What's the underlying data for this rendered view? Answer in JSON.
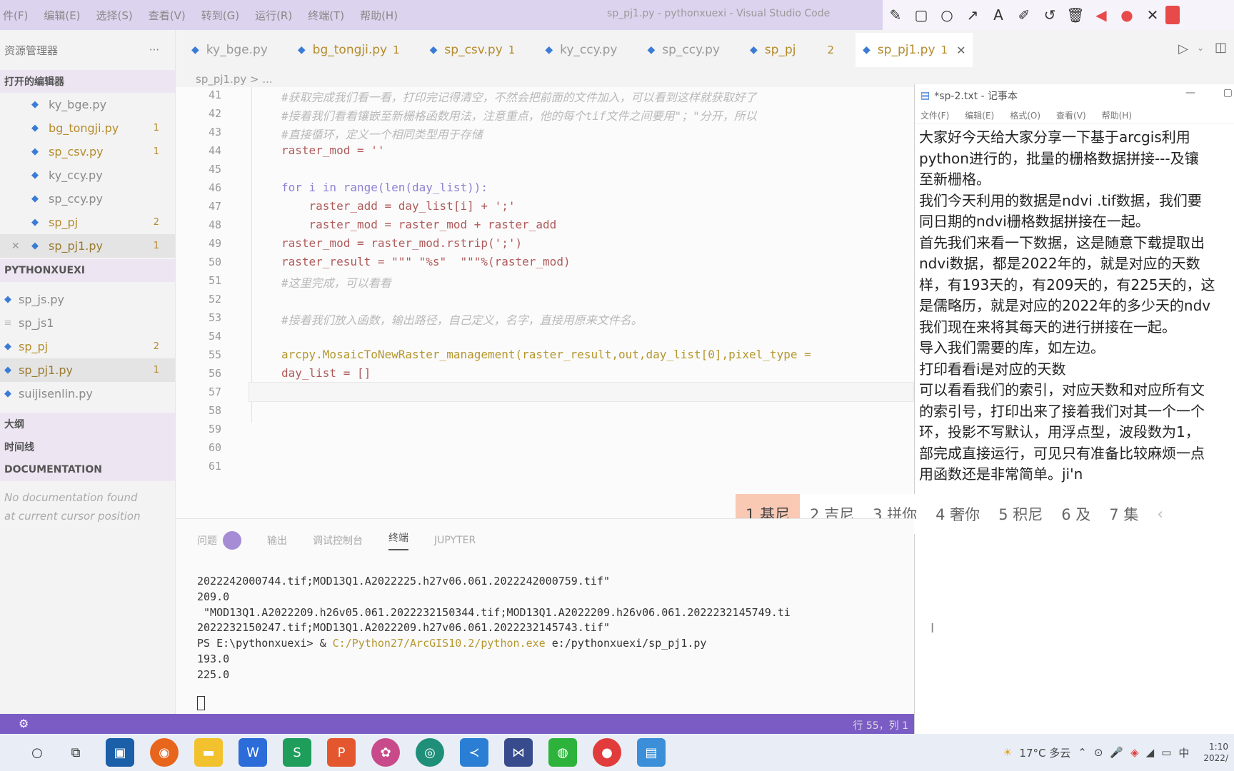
{
  "titlebar": {
    "menus": [
      "件(F)",
      "编辑(E)",
      "选择(S)",
      "查看(V)",
      "转到(G)",
      "运行(R)",
      "终端(T)",
      "帮助(H)"
    ],
    "title": "sp_pj1.py - pythonxuexi - Visual Studio Code"
  },
  "sidebar": {
    "explorer_label": "资源管理器",
    "more": "···",
    "open_editors_header": "打开的编辑器",
    "open_editors": [
      {
        "name": "ky_bge.py",
        "badge": ""
      },
      {
        "name": "bg_tongji.py",
        "badge": "1"
      },
      {
        "name": "sp_csv.py",
        "badge": "1"
      },
      {
        "name": "ky_ccy.py",
        "badge": ""
      },
      {
        "name": "sp_ccy.py",
        "badge": ""
      },
      {
        "name": "sp_pj",
        "badge": "2"
      },
      {
        "name": "sp_pj1.py",
        "badge": "1",
        "close": "✕"
      }
    ],
    "project_header": "PYTHONXUEXI",
    "project_files": [
      {
        "name": "sp_js.py",
        "badge": ""
      },
      {
        "name": "sp_js1",
        "badge": ""
      },
      {
        "name": "sp_pj",
        "badge": "2"
      },
      {
        "name": "sp_pj1.py",
        "badge": "1"
      },
      {
        "name": "suijisenlin.py",
        "badge": ""
      }
    ],
    "outline_header": "大纲",
    "timeline_header": "时间线",
    "documentation_header": "DOCUMENTATION",
    "doc_note_1": "No documentation found",
    "doc_note_2": "at current cursor position"
  },
  "tabs": [
    {
      "name": "ky_bge.py",
      "badge": ""
    },
    {
      "name": "bg_tongji.py",
      "badge": "1"
    },
    {
      "name": "sp_csv.py",
      "badge": "1"
    },
    {
      "name": "ky_ccy.py",
      "badge": ""
    },
    {
      "name": "sp_ccy.py",
      "badge": ""
    },
    {
      "name": "sp_pj",
      "badge": "2"
    },
    {
      "name": "sp_pj1.py",
      "badge": "1",
      "close": "✕"
    }
  ],
  "breadcrumb": "sp_pj1.py > ...",
  "editor": {
    "lines": [
      {
        "n": "41",
        "code": "#获取完成我们看一看，打印完记得清空，不然会把前面的文件加入，可以看到这样就获取好了"
      },
      {
        "n": "42",
        "code": "#接着我们看看镶嵌至新栅格函数用法，注意重点，他的每个tif文件之间要用\"；\"分开，所以"
      },
      {
        "n": "43",
        "code": "#直接循环，定义一个相同类型用于存储"
      },
      {
        "n": "44",
        "code": "raster_mod = ''"
      },
      {
        "n": "45",
        "code": ""
      },
      {
        "n": "46",
        "code": "for i in range(len(day_list)):"
      },
      {
        "n": "47",
        "code": "    raster_add = day_list[i] + ';'"
      },
      {
        "n": "48",
        "code": "    raster_mod = raster_mod + raster_add"
      },
      {
        "n": "49",
        "code": "raster_mod = raster_mod.rstrip(';')"
      },
      {
        "n": "50",
        "code": "raster_result = \"\"\" \"%s\"  \"\"\"%(raster_mod)"
      },
      {
        "n": "51",
        "code": "#这里完成，可以看看"
      },
      {
        "n": "52",
        "code": ""
      },
      {
        "n": "53",
        "code": "#接着我们放入函数，输出路径，自己定义，名字，直接用原来文件名。"
      },
      {
        "n": "54",
        "code": ""
      },
      {
        "n": "55",
        "code": "arcpy.MosaicToNewRaster_management(raster_result,out,day_list[0],pixel_type ="
      },
      {
        "n": "56",
        "code": "day_list = []"
      },
      {
        "n": "57",
        "code": ""
      },
      {
        "n": "58",
        "code": ""
      },
      {
        "n": "59",
        "code": ""
      },
      {
        "n": "60",
        "code": ""
      },
      {
        "n": "61",
        "code": ""
      }
    ]
  },
  "notepad": {
    "title": "*sp-2.txt - 记事本",
    "menus": [
      "文件(F)",
      "编辑(E)",
      "格式(O)",
      "查看(V)",
      "帮助(H)"
    ],
    "lines": [
      "大家好今天给大家分享一下基于arcgis利用",
      "python进行的，批量的栅格数据拼接---及镶",
      "至新栅格。",
      "我们今天利用的数据是ndvi .tif数据，我们要",
      "同日期的ndvi栅格数据拼接在一起。",
      "首先我们来看一下数据，这是随意下载提取出",
      "ndvi数据，都是2022年的，就是对应的天数",
      "样，有193天的，有209天的，有225天的，这",
      "是儒略历，就是对应的2022年的多少天的ndv",
      "我们现在来将其每天的进行拼接在一起。",
      "导入我们需要的库，如左边。",
      "打印看看i是对应的天数",
      "可以看看我们的索引，对应天数和对应所有文",
      "的索引号，打印出来了接着我们对其一个一个",
      "环，投影不写默认，用浮点型，波段数为1，",
      "部完成直接运行，可见只有准备比较麻烦一点",
      "用函数还是非常简单。ji'n"
    ]
  },
  "ime": {
    "candidates": [
      "1 基尼",
      "2 吉尼",
      "3 拼你",
      "4 奢你",
      "5 积尼",
      "6 及",
      "7 集"
    ],
    "prev": "‹"
  },
  "panel": {
    "tabs": [
      "问题",
      "输出",
      "调试控制台",
      "终端",
      "JUPYTER"
    ],
    "problem_count": "",
    "terminal": [
      {
        "text": "2022242000744.tif;MOD13Q1.A2022225.h27v06.061.2022242000759.tif\"",
        "path": ""
      },
      {
        "text": "209.0",
        "path": ""
      },
      {
        "text": " \"MOD13Q1.A2022209.h26v05.061.2022232150344.tif;MOD13Q1.A2022209.h26v06.061.2022232145749.ti",
        "path": ""
      },
      {
        "text": "2022232150247.tif;MOD13Q1.A2022209.h27v06.061.2022232145743.tif\"",
        "path": ""
      },
      {
        "text": "PS E:\\pythonxuexi> & ",
        "path": "C:/Python27/ArcGIS10.2/python.exe",
        "after": " e:/pythonxuexi/sp_pj1.py"
      },
      {
        "text": "193.0",
        "path": ""
      },
      {
        "text": "225.0",
        "path": ""
      }
    ]
  },
  "statusbar": {
    "position": "行 55，列 1"
  },
  "taskbar": {
    "weather": "17°C 多云",
    "ime_lang": "中",
    "time": "1:10",
    "date": "2022/"
  }
}
